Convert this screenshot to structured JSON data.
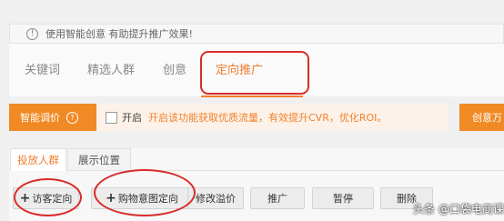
{
  "notice": {
    "text": "使用智能创意 有助提升推广效果!",
    "icon": "info-icon"
  },
  "tabs": [
    {
      "label": "关键词",
      "active": false
    },
    {
      "label": "精选人群",
      "active": false
    },
    {
      "label": "创意",
      "active": false
    },
    {
      "label": "定向推广",
      "active": true
    }
  ],
  "smart_bid": {
    "label": "智能调价",
    "help_icon": "?",
    "checkbox_label": "开启",
    "description": "开启该功能获取优质流量，有效提升CVR，优化ROI。",
    "checked": false
  },
  "creative_button": {
    "label": "创意万"
  },
  "subtabs": [
    {
      "label": "投放人群",
      "active": true
    },
    {
      "label": "展示位置",
      "active": false
    }
  ],
  "actions": {
    "visitor_targeting": "访客定向",
    "purchase_intent": "购物意图定向",
    "modify_premium": "修改溢价",
    "promote": "推广",
    "pause": "暂停",
    "delete": "删除"
  },
  "watermark": "头条 @口袋电商课",
  "colors": {
    "accent": "#f07c2e",
    "highlight_ring": "#d82c2c"
  }
}
